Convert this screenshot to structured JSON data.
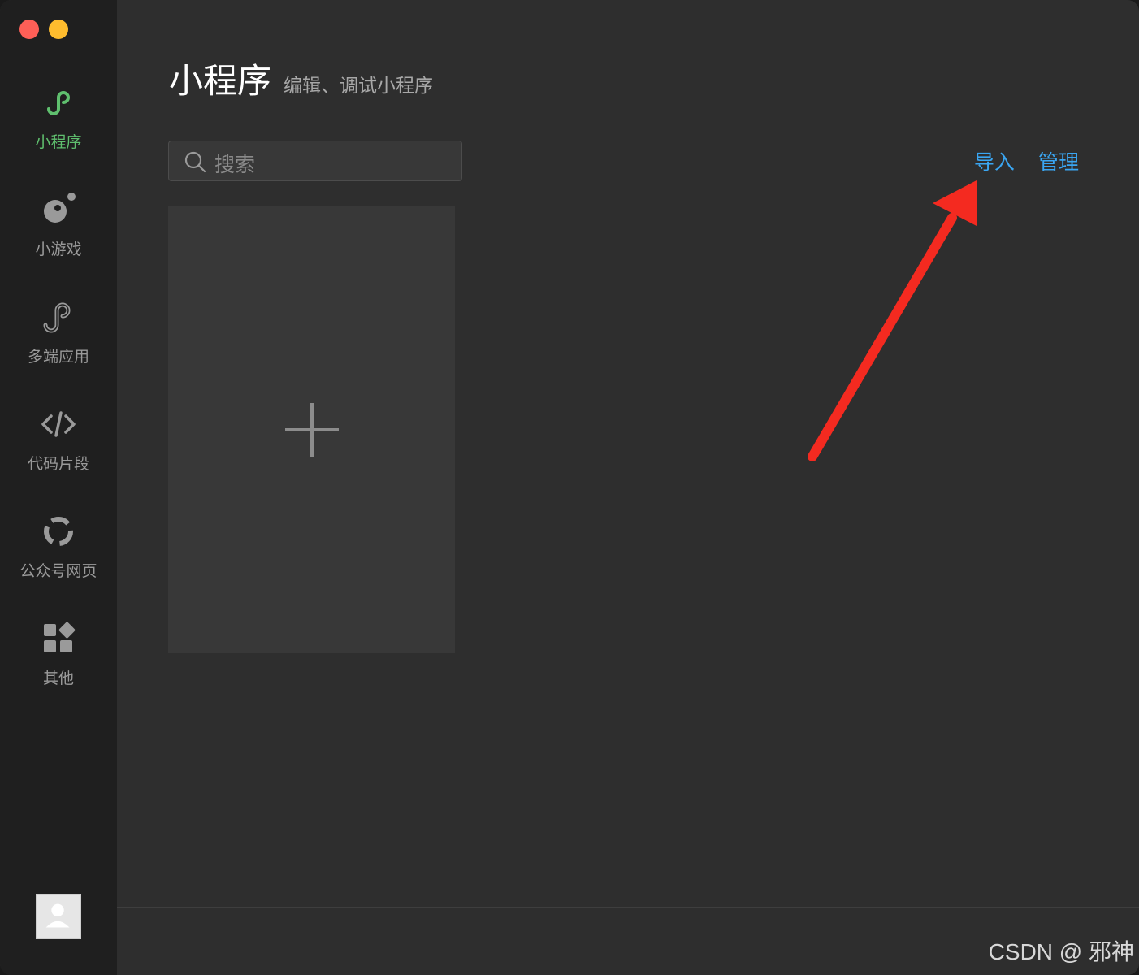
{
  "sidebar": {
    "items": [
      {
        "label": "小程序",
        "icon": "miniprogram-icon",
        "active": true
      },
      {
        "label": "小游戏",
        "icon": "minigame-icon"
      },
      {
        "label": "多端应用",
        "icon": "multiplatform-icon"
      },
      {
        "label": "代码片段",
        "icon": "code-icon"
      },
      {
        "label": "公众号网页",
        "icon": "official-account-icon"
      },
      {
        "label": "其他",
        "icon": "apps-icon"
      }
    ]
  },
  "header": {
    "title": "小程序",
    "subtitle": "编辑、调试小程序"
  },
  "search": {
    "placeholder": "搜索"
  },
  "actions": {
    "import_label": "导入",
    "manage_label": "管理"
  },
  "watermark": "CSDN @ 邪神",
  "colors": {
    "accent_green": "#5fbf6e",
    "link_blue": "#3aa6f2",
    "annotation_red": "#f42a20"
  }
}
